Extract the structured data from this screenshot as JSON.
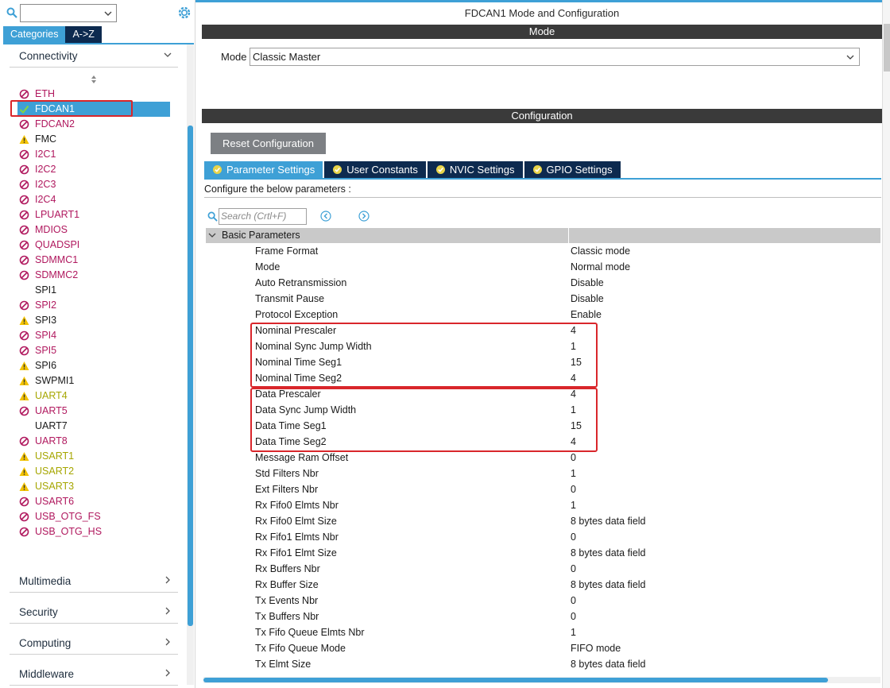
{
  "left_panel": {
    "tabs": [
      {
        "label": "Categories",
        "active": true
      },
      {
        "label": "A->Z",
        "active": false
      }
    ],
    "category_expanded": "Connectivity",
    "peripherals": [
      {
        "name": "ETH",
        "status": "disabled"
      },
      {
        "name": "FDCAN1",
        "status": "enabled",
        "selected": true
      },
      {
        "name": "FDCAN2",
        "status": "disabled"
      },
      {
        "name": "FMC",
        "status": "warning-partial"
      },
      {
        "name": "I2C1",
        "status": "disabled"
      },
      {
        "name": "I2C2",
        "status": "disabled"
      },
      {
        "name": "I2C3",
        "status": "disabled"
      },
      {
        "name": "I2C4",
        "status": "disabled"
      },
      {
        "name": "LPUART1",
        "status": "disabled"
      },
      {
        "name": "MDIOS",
        "status": "disabled"
      },
      {
        "name": "QUADSPI",
        "status": "disabled"
      },
      {
        "name": "SDMMC1",
        "status": "disabled"
      },
      {
        "name": "SDMMC2",
        "status": "disabled"
      },
      {
        "name": "SPI1",
        "status": "none"
      },
      {
        "name": "SPI2",
        "status": "disabled"
      },
      {
        "name": "SPI3",
        "status": "warning-partial"
      },
      {
        "name": "SPI4",
        "status": "disabled"
      },
      {
        "name": "SPI5",
        "status": "disabled"
      },
      {
        "name": "SPI6",
        "status": "warning-partial"
      },
      {
        "name": "SWPMI1",
        "status": "warning-partial"
      },
      {
        "name": "UART4",
        "status": "warning"
      },
      {
        "name": "UART5",
        "status": "disabled"
      },
      {
        "name": "UART7",
        "status": "none"
      },
      {
        "name": "UART8",
        "status": "disabled"
      },
      {
        "name": "USART1",
        "status": "warning"
      },
      {
        "name": "USART2",
        "status": "warning"
      },
      {
        "name": "USART3",
        "status": "warning"
      },
      {
        "name": "USART6",
        "status": "disabled"
      },
      {
        "name": "USB_OTG_FS",
        "status": "disabled"
      },
      {
        "name": "USB_OTG_HS",
        "status": "disabled"
      }
    ],
    "collapsed_categories": [
      "Multimedia",
      "Security",
      "Computing",
      "Middleware"
    ]
  },
  "right_panel": {
    "title": "FDCAN1 Mode and Configuration",
    "mode_bar": "Mode",
    "mode_label": "Mode",
    "mode_value": "Classic Master",
    "config_bar": "Configuration",
    "reset_button": "Reset Configuration",
    "tabs": [
      {
        "label": "Parameter Settings",
        "active": true
      },
      {
        "label": "User Constants",
        "active": false
      },
      {
        "label": "NVIC Settings",
        "active": false
      },
      {
        "label": "GPIO Settings",
        "active": false
      }
    ],
    "hint": "Configure the below parameters :",
    "search_placeholder": "Search (Crtl+F)",
    "group": "Basic Parameters",
    "parameters": [
      {
        "name": "Frame Format",
        "value": "Classic mode"
      },
      {
        "name": "Mode",
        "value": "Normal mode"
      },
      {
        "name": "Auto Retransmission",
        "value": "Disable"
      },
      {
        "name": "Transmit Pause",
        "value": "Disable"
      },
      {
        "name": "Protocol Exception",
        "value": "Enable"
      },
      {
        "name": "Nominal Prescaler",
        "value": "4"
      },
      {
        "name": "Nominal Sync Jump Width",
        "value": "1"
      },
      {
        "name": "Nominal Time Seg1",
        "value": "15"
      },
      {
        "name": "Nominal Time Seg2",
        "value": "4"
      },
      {
        "name": "Data Prescaler",
        "value": "4"
      },
      {
        "name": "Data Sync Jump Width",
        "value": "1"
      },
      {
        "name": "Data Time Seg1",
        "value": "15"
      },
      {
        "name": "Data Time Seg2",
        "value": "4"
      },
      {
        "name": "Message Ram Offset",
        "value": "0"
      },
      {
        "name": "Std Filters Nbr",
        "value": "1"
      },
      {
        "name": "Ext Filters Nbr",
        "value": "0"
      },
      {
        "name": "Rx Fifo0 Elmts Nbr",
        "value": "1"
      },
      {
        "name": "Rx Fifo0 Elmt Size",
        "value": "8 bytes data field"
      },
      {
        "name": "Rx Fifo1 Elmts Nbr",
        "value": "0"
      },
      {
        "name": "Rx Fifo1 Elmt Size",
        "value": "8 bytes data field"
      },
      {
        "name": "Rx Buffers Nbr",
        "value": "0"
      },
      {
        "name": "Rx Buffer Size",
        "value": "8 bytes data field"
      },
      {
        "name": "Tx Events Nbr",
        "value": "0"
      },
      {
        "name": "Tx Buffers Nbr",
        "value": "0"
      },
      {
        "name": "Tx Fifo Queue Elmts Nbr",
        "value": "1"
      },
      {
        "name": "Tx Fifo Queue Mode",
        "value": "FIFO mode"
      },
      {
        "name": "Tx Elmt Size",
        "value": "8 bytes data field"
      }
    ]
  },
  "colors": {
    "accent_blue": "#3ea0d6",
    "dark_tab": "#0d2a4f",
    "section_bar": "#3a3a3a",
    "disabled_text": "#b0185e",
    "warning_text": "#a6a600",
    "highlight_red": "#d9262b"
  }
}
